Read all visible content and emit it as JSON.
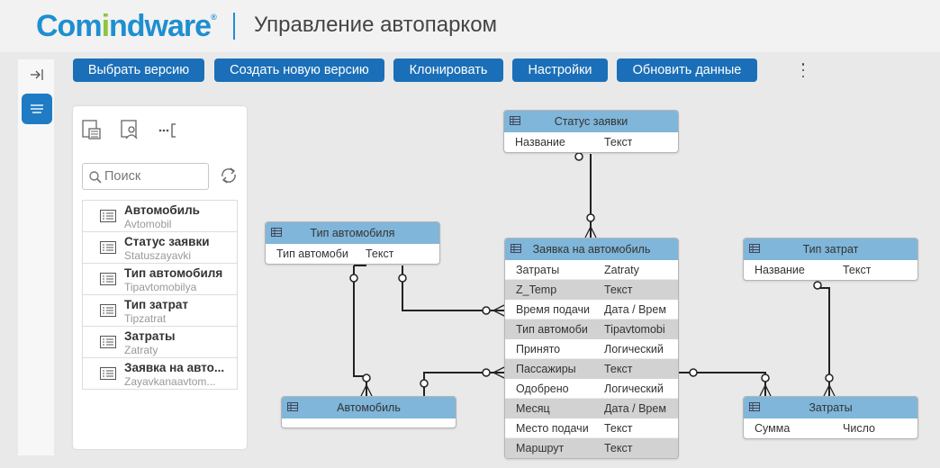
{
  "header": {
    "logo_part1": "Com",
    "logo_part2": "i",
    "logo_part3": "ndware",
    "logo_reg": "®",
    "title": "Управление автопарком"
  },
  "toolbar": {
    "buttons": [
      {
        "label": "Выбрать версию"
      },
      {
        "label": "Создать новую версию"
      },
      {
        "label": "Клонировать"
      },
      {
        "label": "Настройки"
      },
      {
        "label": "Обновить данные"
      }
    ]
  },
  "search": {
    "placeholder": "Поиск"
  },
  "objects": [
    {
      "name": "Автомобиль",
      "alias": "Avtomobil"
    },
    {
      "name": "Статус заявки",
      "alias": "Statuszayavki"
    },
    {
      "name": "Тип автомобиля",
      "alias": "Tipavtomobilya"
    },
    {
      "name": "Тип затрат",
      "alias": "Tipzatrat"
    },
    {
      "name": "Затраты",
      "alias": "Zatraty"
    },
    {
      "name": "Заявка на авто...",
      "alias": "Zayavkanaavtom..."
    }
  ],
  "entities": {
    "status": {
      "title": "Статус заявки",
      "fields": [
        {
          "name": "Название",
          "type": "Текст"
        }
      ]
    },
    "car_type": {
      "title": "Тип автомобиля",
      "fields": [
        {
          "name": "Тип автомоби",
          "type": "Текст"
        }
      ]
    },
    "request": {
      "title": "Заявка на автомобиль",
      "fields": [
        {
          "name": "Затраты",
          "type": "Zatraty"
        },
        {
          "name": "Z_Temp",
          "type": "Текст"
        },
        {
          "name": "Время подачи",
          "type": "Дата / Врем"
        },
        {
          "name": "Тип автомоби",
          "type": "Tipavtomobi"
        },
        {
          "name": "Принято",
          "type": "Логический"
        },
        {
          "name": "Пассажиры",
          "type": "Текст"
        },
        {
          "name": "Одобрено",
          "type": "Логический"
        },
        {
          "name": "Месяц",
          "type": "Дата / Врем"
        },
        {
          "name": "Место подачи",
          "type": "Текст"
        },
        {
          "name": "Маршрут",
          "type": "Текст"
        }
      ]
    },
    "cost_type": {
      "title": "Тип затрат",
      "fields": [
        {
          "name": "Название",
          "type": "Текст"
        }
      ]
    },
    "car": {
      "title": "Автомобиль",
      "fields": []
    },
    "costs": {
      "title": "Затраты",
      "fields": [
        {
          "name": "Сумма",
          "type": "Число"
        }
      ]
    }
  },
  "colors": {
    "button_bg": "#1b6fb8",
    "entity_header": "#7fb6d9",
    "logo_blue": "#1e8fd0",
    "logo_green": "#8cc63f"
  }
}
